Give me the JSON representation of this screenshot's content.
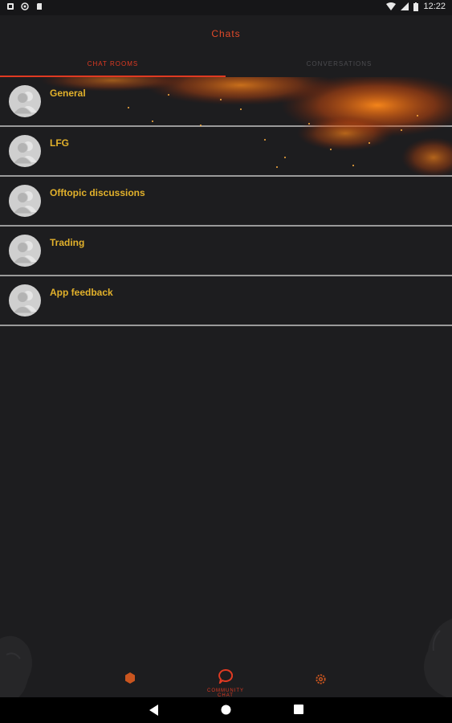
{
  "status_bar": {
    "time": "12:22"
  },
  "app": {
    "title": "Chats"
  },
  "tabs": [
    {
      "label": "Chat rooms"
    },
    {
      "label": "Conversations"
    }
  ],
  "rooms": [
    {
      "name": "General"
    },
    {
      "name": "LFG"
    },
    {
      "name": "Offtopic discussions"
    },
    {
      "name": "Trading"
    },
    {
      "name": "App feedback"
    }
  ],
  "bottom_nav": {
    "home_icon": "hexagon-icon",
    "chat_label": "Community chat",
    "settings_icon": "gear-icon"
  },
  "colors": {
    "accent": "#e03a22",
    "room_label": "#e2b12b",
    "background": "#1d1d1f",
    "divider": "#9a9a9a"
  }
}
